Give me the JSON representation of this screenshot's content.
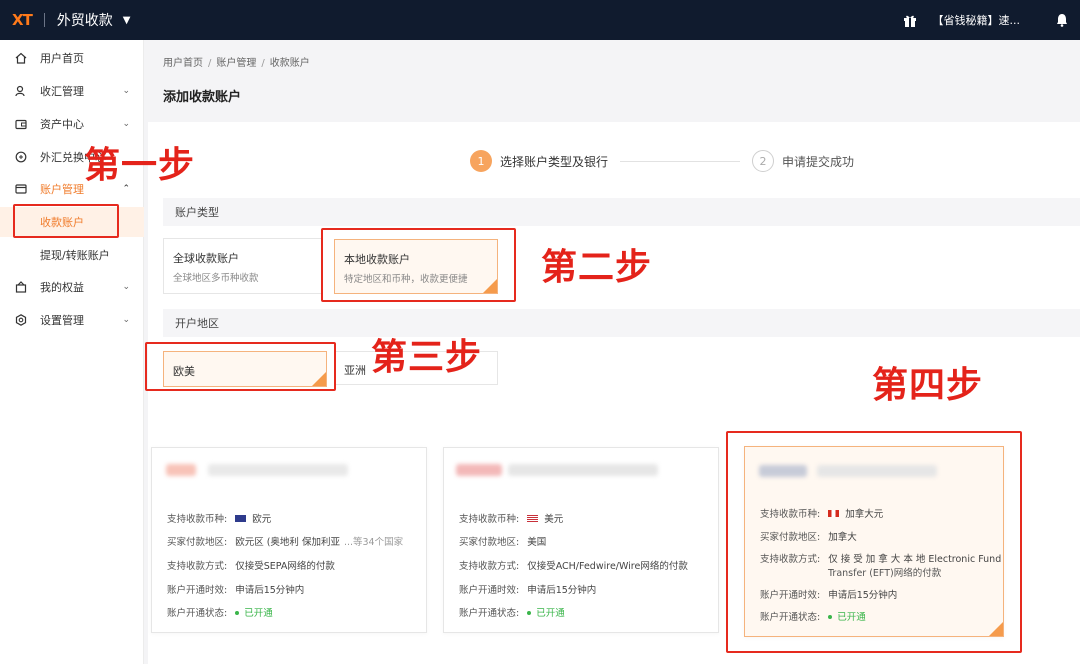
{
  "topbar": {
    "logo": "XT",
    "app_title": "外贸收款",
    "caret": "▼",
    "user": "【省钱秘籍】速..."
  },
  "sidebar": {
    "items": [
      {
        "label": "用户首页"
      },
      {
        "label": "收汇管理"
      },
      {
        "label": "资产中心"
      },
      {
        "label": "外汇兑换中心"
      },
      {
        "label": "账户管理"
      },
      {
        "label": "收款账户"
      },
      {
        "label": "提现/转账账户"
      },
      {
        "label": "我的权益"
      },
      {
        "label": "设置管理"
      }
    ]
  },
  "breadcrumb": {
    "items": [
      "用户首页",
      "账户管理",
      "收款账户"
    ],
    "sep": "/"
  },
  "page_title": "添加收款账户",
  "steps": [
    {
      "num": "1",
      "label": "选择账户类型及银行"
    },
    {
      "num": "2",
      "label": "申请提交成功"
    }
  ],
  "account_type": {
    "header": "账户类型",
    "options": [
      {
        "title": "全球收款账户",
        "desc": "全球地区多币种收款"
      },
      {
        "title": "本地收款账户",
        "desc": "特定地区和币种，收款更便捷"
      }
    ]
  },
  "region": {
    "header": "开户地区",
    "options": [
      {
        "title": "欧美"
      },
      {
        "title": "亚洲"
      }
    ]
  },
  "annotations": {
    "step1": "第一步",
    "step2": "第二步",
    "step3": "第三步",
    "step4": "第四步"
  },
  "labels": {
    "currency": "支持收款币种:",
    "payer_region": "买家付款地区:",
    "method": "支持收款方式:",
    "open_time": "账户开通时效:",
    "status": "账户开通状态:"
  },
  "cards": [
    {
      "currency": "欧元",
      "payer_region": "欧元区 (奥地利 保加利亚",
      "payer_more": "...等34个国家",
      "method": "仅接受SEPA网络的付款",
      "open_time": "申请后15分钟内",
      "status": "已开通"
    },
    {
      "currency": "美元",
      "payer_region": "美国",
      "method": "仅接受ACH/Fedwire/Wire网络的付款",
      "open_time": "申请后15分钟内",
      "status": "已开通"
    },
    {
      "currency": "加拿大元",
      "payer_region": "加拿大",
      "method": "仅 接 受 加 拿 大 本 地 Electronic  Fund",
      "method2": "Transfer (EFT)网络的付款",
      "open_time": "申请后15分钟内",
      "status": "已开通"
    }
  ],
  "colors": {
    "accent": "#f07b2a",
    "annotation_red": "#e4231a",
    "topbar_bg": "#101b2e",
    "status_green": "#3ab54a"
  }
}
